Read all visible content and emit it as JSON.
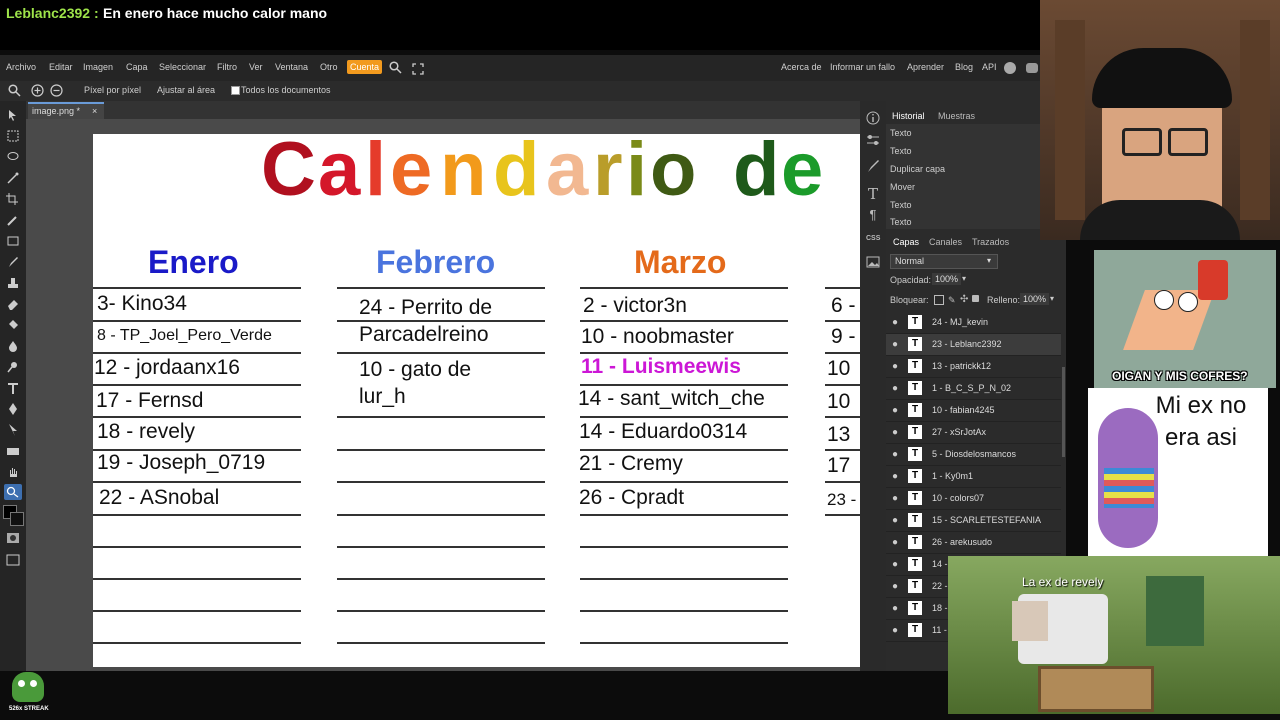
{
  "chat": {
    "user": "Leblanc2392 :",
    "message": "En enero hace mucho calor mano"
  },
  "menu": {
    "items": [
      "Archivo",
      "Editar",
      "Imagen",
      "Capa",
      "Seleccionar",
      "Filtro",
      "Ver",
      "Ventana",
      "Otro",
      "Cuenta"
    ],
    "right_links": [
      "Acerca de",
      "Informar un fallo",
      "Aprender",
      "Blog",
      "API"
    ]
  },
  "options": {
    "pixel": "Píxel por píxel",
    "fit": "Ajustar al área",
    "all_docs": "Todos los documentos"
  },
  "tab": {
    "name": "image.png *",
    "close": "×"
  },
  "canvas": {
    "title_letters": [
      "C",
      "a",
      "l",
      "e",
      "n",
      "d",
      "a",
      "r",
      "i",
      "o",
      " ",
      "d",
      "e"
    ],
    "title_colors": [
      "#b0101f",
      "#d4172a",
      "#e53b2b",
      "#ee6a24",
      "#f29a1b",
      "#e8c41c",
      "#f2b891",
      "#b99d2a",
      "#7a8a18",
      "#3f5a14",
      "#ffffff",
      "#1e5a1a",
      "#1b9b2a"
    ],
    "months": [
      {
        "name": "Enero",
        "color": "#1a1ac8"
      },
      {
        "name": "Febrero",
        "color": "#4a74de"
      },
      {
        "name": "Marzo",
        "color": "#e46a1a"
      }
    ],
    "enero": [
      "3- Kino34",
      "8 - TP_Joel_Pero_Verde",
      "12 - jordaanx16",
      "17 - Fernsd",
      "18 - revely",
      "19 - Joseph_0719",
      "22 - ASnobal"
    ],
    "febrero": [
      "24 - Perrito de",
      "Parcadelreino",
      "10 - gato de",
      "lur_h"
    ],
    "marzo": [
      "2 - victor3n",
      "10 - noobmaster",
      "11 - Luismeewis",
      "14 - sant_witch_che",
      "14 - Eduardo0314",
      "21 - Cremy",
      "26 - Cpradt"
    ],
    "abril": [
      "6 -",
      "9 -",
      "10",
      "10",
      "13",
      "17",
      "23 -"
    ]
  },
  "history": {
    "tabs": [
      "Historial",
      "Muestras"
    ],
    "items": [
      "Texto",
      "Texto",
      "Duplicar capa",
      "Mover",
      "Texto",
      "Texto"
    ]
  },
  "layers": {
    "tabs": [
      "Capas",
      "Canales",
      "Trazados"
    ],
    "blend": "Normal",
    "opacity_label": "Opacidad:",
    "opacity": "100%",
    "lock_label": "Bloquear:",
    "fill_label": "Relleno:",
    "fill": "100%",
    "items": [
      "24 - MJ_kevin",
      "23 - Leblanc2392",
      "13 - patrickk12",
      "1 - B_C_S_P_N_02",
      "10 - fabian4245",
      "27 - xSrJotAx",
      "5 - Diosdelosmancos",
      "1 - Ky0m1",
      "10 - colors07",
      "15 - SCARLETESTEFANIA",
      "26 - arekusudo",
      "14 -",
      "22 -",
      "18 -",
      "11 -"
    ]
  },
  "overlays": {
    "meme1_caption": "OIGAN Y MIS COFRES?",
    "meme2_caption": "Mi ex no era asi",
    "meme3_caption": "La ex de revely",
    "streak": "526x STREAK"
  }
}
